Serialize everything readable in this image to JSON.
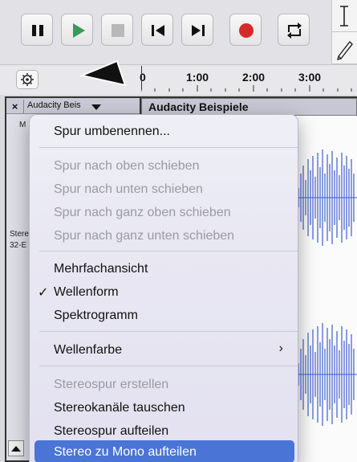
{
  "timeline": {
    "labels": [
      "0",
      "1:00",
      "2:00",
      "3:00"
    ]
  },
  "track": {
    "close_label": "×",
    "name": "Audacity Beis",
    "side_labels": [
      "M",
      "Stere",
      "32-E"
    ],
    "waveform_title": "Audacity Beispiele"
  },
  "menu": {
    "items": [
      {
        "label": "Spur umbenennen...",
        "enabled": true
      },
      {
        "label": "Spur nach oben schieben",
        "enabled": false
      },
      {
        "label": "Spur nach unten schieben",
        "enabled": false
      },
      {
        "label": "Spur nach ganz oben schieben",
        "enabled": false
      },
      {
        "label": "Spur nach ganz unten schieben",
        "enabled": false
      },
      {
        "label": "Mehrfachansicht",
        "enabled": true
      },
      {
        "label": "Wellenform",
        "enabled": true,
        "checked": true,
        "check_glyph": "✓"
      },
      {
        "label": "Spektrogramm",
        "enabled": true
      },
      {
        "label": "Wellenfarbe",
        "enabled": true,
        "submenu_glyph": "›"
      },
      {
        "label": "Stereospur erstellen",
        "enabled": false
      },
      {
        "label": "Stereokanäle tauschen",
        "enabled": true
      },
      {
        "label": "Stereospur aufteilen",
        "enabled": true
      },
      {
        "label": "Stereo zu Mono aufteilen",
        "enabled": true,
        "highlighted": true
      }
    ]
  },
  "colors": {
    "play": "#3a9a5a",
    "record": "#d42a2a",
    "waveform": "#3b5fd0",
    "highlight": "#4a74d6"
  }
}
